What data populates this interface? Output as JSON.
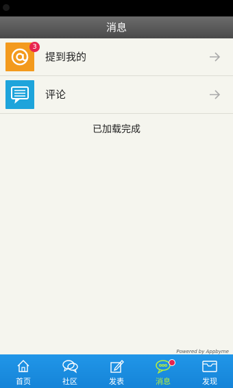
{
  "header": {
    "title": "消息"
  },
  "messages": {
    "items": [
      {
        "label": "提到我的",
        "icon": "at-icon"
      },
      {
        "label": "评论",
        "icon": "comment-icon",
        "badge": "3"
      }
    ],
    "loaded_text": "已加载完成"
  },
  "powered_by": "Powered by Appbyme",
  "tabs": [
    {
      "label": "首页",
      "icon": "home-icon"
    },
    {
      "label": "社区",
      "icon": "community-icon"
    },
    {
      "label": "发表",
      "icon": "compose-icon"
    },
    {
      "label": "消息",
      "icon": "message-icon",
      "active": true
    },
    {
      "label": "发现",
      "icon": "discover-icon"
    }
  ],
  "colors": {
    "tab_bar": "#1a8ce0",
    "active_tab": "#b8f03a",
    "badge": "#e8244f",
    "at_icon_bg": "#f39a1d",
    "chat_icon_bg": "#1ea4db"
  }
}
